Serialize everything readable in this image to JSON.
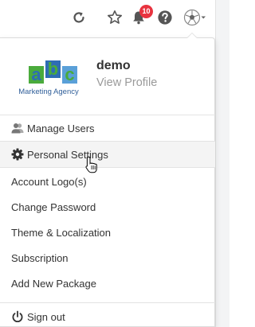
{
  "topbar": {
    "icons": {
      "refresh": "refresh-icon",
      "favorite": "star-icon",
      "notifications": "bell-icon",
      "help": "help-icon",
      "profile": "soccer-ball-avatar-icon"
    },
    "notification_count": "10"
  },
  "profile": {
    "logo_letters": [
      "a",
      "b",
      "c"
    ],
    "logo_tagline": "Marketing Agency",
    "user_name": "demo",
    "view_profile_label": "View Profile"
  },
  "menu": {
    "manage_users": "Manage Users",
    "personal_settings": "Personal Settings",
    "account_logos": "Account Logo(s)",
    "change_password": "Change Password",
    "theme_localization": "Theme & Localization",
    "subscription": "Subscription",
    "add_new_package": "Add New Package",
    "sign_out": "Sign out"
  },
  "colors": {
    "badge": "#e8333f",
    "logo_green": "#4aab3c",
    "logo_blue": "#2e6db4",
    "logo_lightblue": "#5aa0d8",
    "text": "#333333",
    "muted": "#9a9a9a",
    "hover_row": "#f4f4f4"
  }
}
